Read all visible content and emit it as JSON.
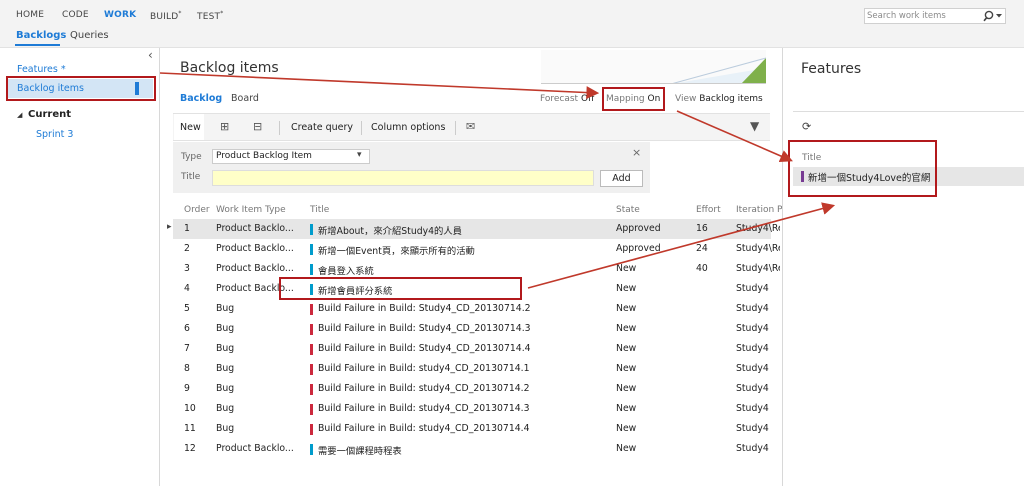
{
  "nav": {
    "tabs": [
      {
        "label": "HOME",
        "marker": ""
      },
      {
        "label": "CODE",
        "marker": ""
      },
      {
        "label": "WORK",
        "marker": ""
      },
      {
        "label": "BUILD",
        "marker": "*"
      },
      {
        "label": "TEST",
        "marker": "*"
      }
    ],
    "subtabs": [
      "Backlogs",
      "Queries"
    ],
    "search_placeholder": "Search work items",
    "search_icon": "search-icon"
  },
  "left": {
    "collapse_glyph": "‹",
    "features_link": "Features *",
    "backlog_link": "Backlog items",
    "current_label": "Current",
    "current_glyph": "◢",
    "sprint_link": "Sprint 3"
  },
  "main": {
    "title": "Backlog items",
    "view_tabs": [
      "Backlog",
      "Board"
    ],
    "forecast_label": "Forecast",
    "forecast_value": "Off",
    "mapping_label": "Mapping",
    "mapping_value": "On",
    "view_label": "View",
    "view_value": "Backlog items",
    "toolbar": {
      "new": "New",
      "expand_glyph": "⊞",
      "collapse_glyph": "⊟",
      "create_query": "Create query",
      "column_options": "Column options",
      "mail_glyph": "✉",
      "filter_glyph": "▼"
    },
    "quick_add": {
      "type_label": "Type",
      "type_value": "Product Backlog Item",
      "dropdown_glyph": "▾",
      "close_glyph": "×",
      "title_label": "Title",
      "title_value": "",
      "add_button": "Add"
    },
    "columns": [
      "Order",
      "Work Item Type",
      "Title",
      "State",
      "Effort",
      "Iteration P"
    ],
    "rows": [
      {
        "order": "1",
        "type": "Product Backlo...",
        "title": "新增About，來介紹Study4的人員",
        "state": "Approved",
        "effort": "16",
        "iteration": "Study4\\Re",
        "color": "#009ccc"
      },
      {
        "order": "2",
        "type": "Product Backlo...",
        "title": "新增一個Event頁，來顯示所有的活動",
        "state": "Approved",
        "effort": "24",
        "iteration": "Study4\\Re",
        "color": "#009ccc"
      },
      {
        "order": "3",
        "type": "Product Backlo...",
        "title": "會員登入系統",
        "state": "New",
        "effort": "40",
        "iteration": "Study4\\Re",
        "color": "#009ccc"
      },
      {
        "order": "4",
        "type": "Product Backlo...",
        "title": "新增會員評分系統",
        "state": "New",
        "effort": "",
        "iteration": "Study4",
        "color": "#009ccc"
      },
      {
        "order": "5",
        "type": "Bug",
        "title": "Build Failure in Build: Study4_CD_20130714.2",
        "state": "New",
        "effort": "",
        "iteration": "Study4",
        "color": "#cc293d"
      },
      {
        "order": "6",
        "type": "Bug",
        "title": "Build Failure in Build: Study4_CD_20130714.3",
        "state": "New",
        "effort": "",
        "iteration": "Study4",
        "color": "#cc293d"
      },
      {
        "order": "7",
        "type": "Bug",
        "title": "Build Failure in Build: Study4_CD_20130714.4",
        "state": "New",
        "effort": "",
        "iteration": "Study4",
        "color": "#cc293d"
      },
      {
        "order": "8",
        "type": "Bug",
        "title": "Build Failure in Build: study4_CD_20130714.1",
        "state": "New",
        "effort": "",
        "iteration": "Study4",
        "color": "#cc293d"
      },
      {
        "order": "9",
        "type": "Bug",
        "title": "Build Failure in Build: study4_CD_20130714.2",
        "state": "New",
        "effort": "",
        "iteration": "Study4",
        "color": "#cc293d"
      },
      {
        "order": "10",
        "type": "Bug",
        "title": "Build Failure in Build: study4_CD_20130714.3",
        "state": "New",
        "effort": "",
        "iteration": "Study4",
        "color": "#cc293d"
      },
      {
        "order": "11",
        "type": "Bug",
        "title": "Build Failure in Build: study4_CD_20130714.4",
        "state": "New",
        "effort": "",
        "iteration": "Study4",
        "color": "#cc293d"
      },
      {
        "order": "12",
        "type": "Product Backlo...",
        "title": "需要一個課程時程表",
        "state": "New",
        "effort": "",
        "iteration": "Study4",
        "color": "#009ccc"
      }
    ]
  },
  "right": {
    "title": "Features",
    "refresh_glyph": "⟳",
    "column_label": "Title",
    "items": [
      {
        "title": "新增一個Study4Love的官網",
        "color": "#773b93"
      }
    ]
  },
  "colors": {
    "accent": "#1e7bd6",
    "annotation": "#b2191c",
    "selected_row": "#e6e6e6",
    "quick_add_bg": "#f0f0f0",
    "title_input_bg": "#ffffc8"
  }
}
